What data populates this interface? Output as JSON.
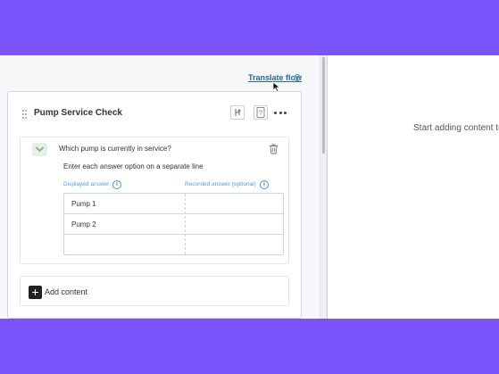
{
  "toolbar": {
    "translate_label": "Translate flow",
    "info_icon": "i"
  },
  "flow": {
    "title": "Pump Service Check",
    "question": {
      "text": "Which pump is currently in service?",
      "hint": "Enter each answer option on a separate line",
      "columns": {
        "displayed": "Displayed answer",
        "recorded": "Recorded answer (optional)"
      },
      "info_icon": "i",
      "answers": [
        {
          "displayed": "Pump 1",
          "recorded": ""
        },
        {
          "displayed": "Pump 2",
          "recorded": ""
        },
        {
          "displayed": "",
          "recorded": ""
        }
      ]
    },
    "add_content_label": "Add content",
    "add_icon": "+"
  },
  "preview": {
    "empty_message": "Start adding content to this flow"
  },
  "icons": {
    "drag": "drag-handle-icon",
    "branch": "branch-icon",
    "help": "help-icon",
    "more": "more-horizontal-icon",
    "chevron": "chevron-down-icon",
    "trash": "trash-icon",
    "cursor": "mouse-cursor-icon"
  },
  "colors": {
    "brand_purple": "#7a53fb",
    "link_blue": "#2a64a3",
    "label_blue": "#4aa3d8",
    "chevron_bg": "#e2f0e8",
    "card_border": "#cdd6e8"
  }
}
